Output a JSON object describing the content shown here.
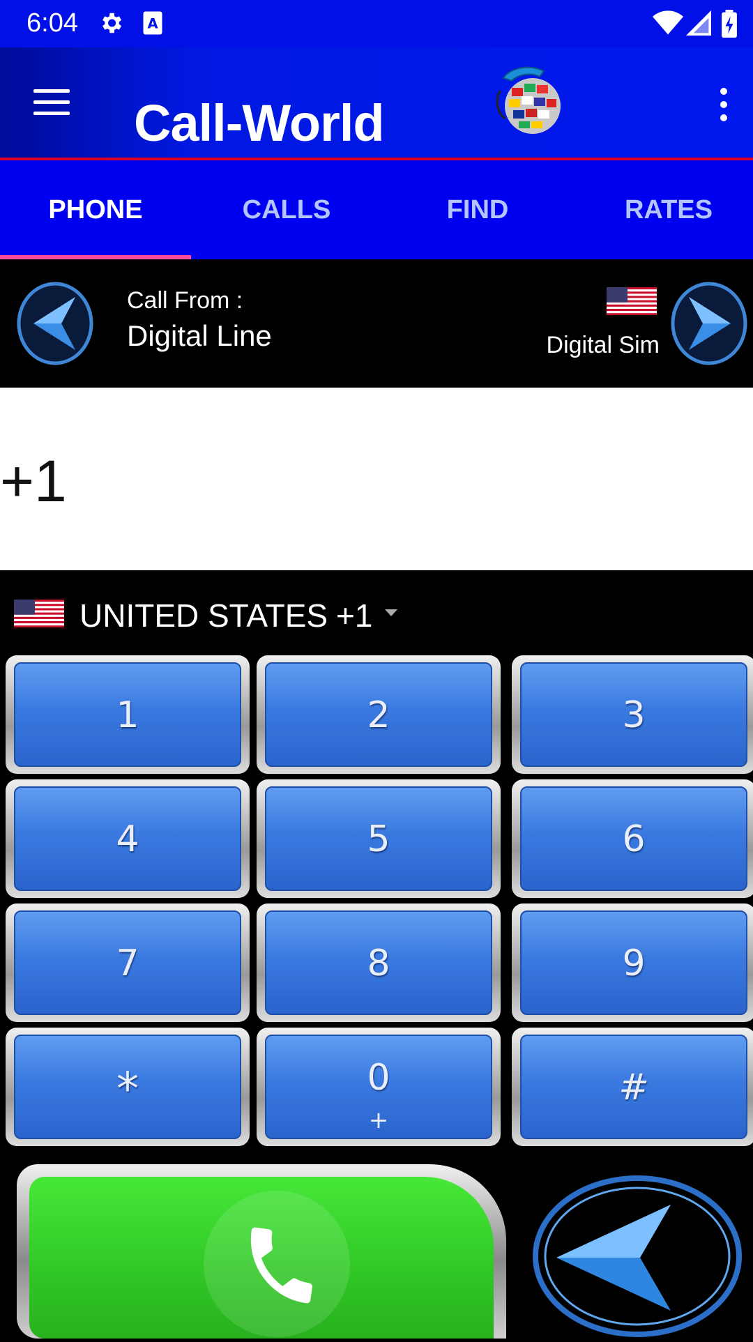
{
  "status_bar": {
    "time": "6:04",
    "icons": [
      "gear-icon",
      "font-a-icon",
      "wifi-icon",
      "signal-icon",
      "battery-charging-icon"
    ]
  },
  "app_bar": {
    "title": "Call-World",
    "menu_icon": "hamburger-menu-icon",
    "logo": "globe-phone-logo",
    "overflow_icon": "more-vert-icon"
  },
  "tabs": [
    {
      "label": "PHONE",
      "active": true
    },
    {
      "label": "CALLS",
      "active": false
    },
    {
      "label": "FIND",
      "active": false
    },
    {
      "label": "RATES",
      "active": false
    }
  ],
  "call_from": {
    "label": "Call From :",
    "value": "Digital Line",
    "sim_label": "Digital Sim",
    "flag": "us-flag-icon"
  },
  "dialer": {
    "number": "+1"
  },
  "country": {
    "name": "UNITED STATES",
    "code": "+1",
    "flag": "us-flag-icon"
  },
  "keypad": {
    "keys": [
      {
        "label": "1",
        "sub": ""
      },
      {
        "label": "2",
        "sub": ""
      },
      {
        "label": "3",
        "sub": ""
      },
      {
        "label": "4",
        "sub": ""
      },
      {
        "label": "5",
        "sub": ""
      },
      {
        "label": "6",
        "sub": ""
      },
      {
        "label": "7",
        "sub": ""
      },
      {
        "label": "8",
        "sub": ""
      },
      {
        "label": "9",
        "sub": ""
      },
      {
        "label": "*",
        "sub": ""
      },
      {
        "label": "0",
        "sub": "+"
      },
      {
        "label": "#",
        "sub": ""
      }
    ]
  },
  "colors": {
    "status_bar": "#0010e6",
    "app_bar": "#0018e0",
    "tab_bar": "#0000f0",
    "tab_indicator": "#ff4aa0",
    "key_blue": "#3a7ae0",
    "call_green": "#33cc28"
  }
}
